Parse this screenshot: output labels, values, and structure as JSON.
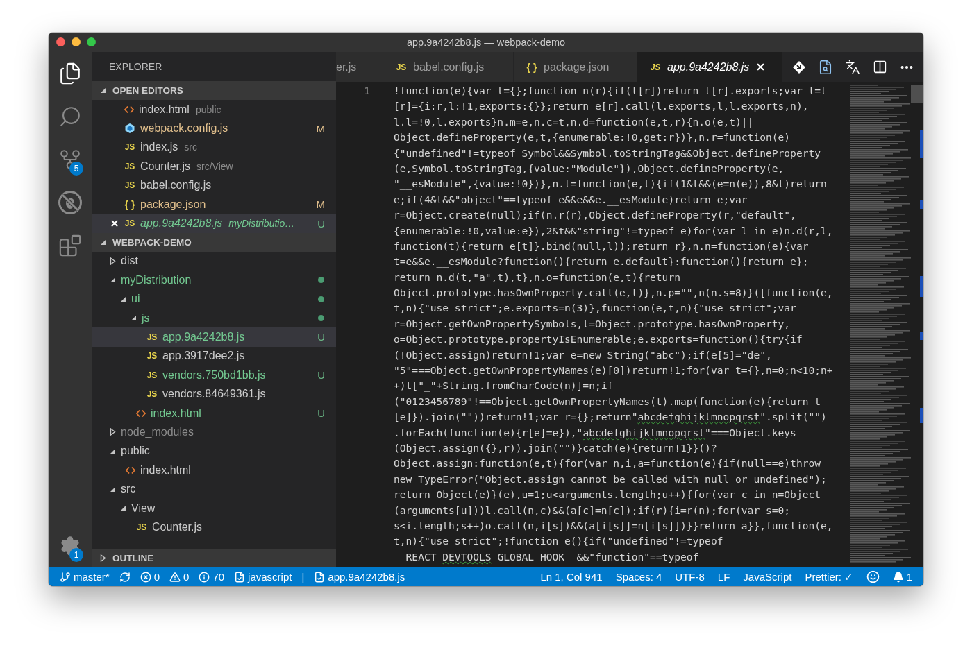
{
  "window": {
    "title": "app.9a4242b8.js — webpack-demo"
  },
  "activity_bar": {
    "items": [
      {
        "kind": "files",
        "selected": true
      },
      {
        "kind": "search",
        "selected": false
      },
      {
        "kind": "source-control",
        "selected": false,
        "badge": "5"
      },
      {
        "kind": "debug",
        "selected": false
      },
      {
        "kind": "extensions",
        "selected": false
      }
    ],
    "settings": {
      "badge": "1"
    }
  },
  "sidebar": {
    "title": "EXPLORER",
    "open_editors": {
      "title": "OPEN EDITORS",
      "expanded": true,
      "items": [
        {
          "kind": "html",
          "name": "index.html",
          "description": "public",
          "color": "#cccccc",
          "selected": false,
          "preview": false
        },
        {
          "kind": "webpack",
          "name": "webpack.config.js",
          "color": "#e2c08d",
          "decoration": "M",
          "selected": false,
          "preview": false
        },
        {
          "kind": "js",
          "glyph": "JS",
          "name": "index.js",
          "description": "src",
          "color": "#cccccc",
          "selected": false,
          "preview": false
        },
        {
          "kind": "js",
          "glyph": "JS",
          "name": "Counter.js",
          "description": "src/View",
          "color": "#cccccc",
          "selected": false,
          "preview": false
        },
        {
          "kind": "js",
          "glyph": "JS",
          "name": "babel.config.js",
          "color": "#cccccc",
          "selected": false,
          "preview": false
        },
        {
          "kind": "json",
          "glyph": "{ }",
          "name": "package.json",
          "color": "#e2c08d",
          "decoration": "M",
          "selected": false,
          "preview": false
        },
        {
          "kind": "js",
          "glyph": "JS",
          "name": "app.9a4242b8.js",
          "description": "myDistributio…",
          "color": "#73c991",
          "decoration": "U",
          "selected": true,
          "preview": true
        }
      ]
    },
    "project": {
      "title": "WEBPACK-DEMO",
      "expanded": true,
      "tree": [
        {
          "kind": "folder",
          "name": "dist",
          "expanded": false,
          "color": "#cccccc",
          "dot": false
        },
        {
          "kind": "folder",
          "name": "myDistribution",
          "expanded": true,
          "color": "#73c991",
          "dot": true,
          "children": [
            {
              "kind": "folder",
              "name": "ui",
              "expanded": true,
              "color": "#73c991",
              "dot": true,
              "children": [
                {
                  "kind": "folder",
                  "name": "js",
                  "expanded": true,
                  "color": "#73c991",
                  "dot": true,
                  "children": [
                    {
                      "kind": "js",
                      "glyph": "JS",
                      "name": "app.9a4242b8.js",
                      "color": "#73c991",
                      "dot": false,
                      "decoration": "U",
                      "selected": true
                    },
                    {
                      "kind": "js",
                      "glyph": "JS",
                      "name": "app.3917dee2.js",
                      "color": "#cccccc",
                      "dot": false,
                      "selected": false
                    },
                    {
                      "kind": "js",
                      "glyph": "JS",
                      "name": "vendors.750bd1bb.js",
                      "color": "#73c991",
                      "dot": false,
                      "decoration": "U",
                      "selected": false
                    },
                    {
                      "kind": "js",
                      "glyph": "JS",
                      "name": "vendors.84649361.js",
                      "color": "#cccccc",
                      "dot": false,
                      "selected": false
                    }
                  ]
                },
                {
                  "kind": "html",
                  "name": "index.html",
                  "color": "#73c991",
                  "dot": false,
                  "decoration": "U",
                  "selected": false
                }
              ]
            }
          ]
        },
        {
          "kind": "folder",
          "name": "node_modules",
          "expanded": false,
          "color": "#8c8c8c",
          "dot": false
        },
        {
          "kind": "folder",
          "name": "public",
          "expanded": true,
          "color": "#cccccc",
          "dot": false,
          "children": [
            {
              "kind": "html",
              "name": "index.html",
              "color": "#cccccc",
              "dot": false,
              "selected": false
            }
          ]
        },
        {
          "kind": "folder",
          "name": "src",
          "expanded": true,
          "color": "#cccccc",
          "dot": false,
          "children": [
            {
              "kind": "folder",
              "name": "View",
              "expanded": true,
              "color": "#cccccc",
              "dot": false,
              "children": [
                {
                  "kind": "js",
                  "glyph": "JS",
                  "name": "Counter.js",
                  "color": "#cccccc",
                  "dot": false,
                  "selected": false
                }
              ]
            }
          ]
        }
      ]
    },
    "outline": {
      "title": "OUTLINE",
      "expanded": false
    }
  },
  "tabs": [
    {
      "kind": "none",
      "label": "er.js",
      "selected": false,
      "preview": false
    },
    {
      "kind": "js",
      "glyph": "JS",
      "label": "babel.config.js",
      "selected": false,
      "preview": false
    },
    {
      "kind": "json",
      "glyph": "{ }",
      "label": "package.json",
      "selected": false,
      "preview": false
    },
    {
      "kind": "js",
      "glyph": "JS",
      "label": "app.9a4242b8.js",
      "selected": true,
      "preview": true
    }
  ],
  "editor": {
    "line_number": "1",
    "lines": [
      {
        "segments": [
          {
            "text": "!function(e){var t={};function n(r){if(t[r])return t[r].exports;var l=t",
            "squiggle": false
          }
        ]
      },
      {
        "segments": [
          {
            "text": "[r]={i:r,l:!1,exports:{}};return e[r].call(l.exports,l,l.exports,n),",
            "squiggle": false
          }
        ]
      },
      {
        "segments": [
          {
            "text": "l.l=!0,l.exports}n.m=e,n.c=t,n.d=function(e,t,r){n.o(e,t)||",
            "squiggle": false
          }
        ]
      },
      {
        "segments": [
          {
            "text": "Object.defineProperty(e,t,{enumerable:!0,get:r})},n.r=function(e)",
            "squiggle": false
          }
        ]
      },
      {
        "segments": [
          {
            "text": "{\"undefined\"!=typeof Symbol&&Symbol.toStringTag&&Object.defineProperty",
            "squiggle": false
          }
        ]
      },
      {
        "segments": [
          {
            "text": "(e,Symbol.toStringTag,{value:\"Module\"}),Object.defineProperty(e,",
            "squiggle": false
          }
        ]
      },
      {
        "segments": [
          {
            "text": "\"__esModule\",{value:!0})},n.t=function(e,t){if(1&t&&(e=n(e)),8&t)return",
            "squiggle": false
          }
        ]
      },
      {
        "segments": [
          {
            "text": "e;if(4&t&&\"object\"==typeof e&&e&&e.__esModule)return e;var",
            "squiggle": false
          }
        ]
      },
      {
        "segments": [
          {
            "text": "r=Object.create(null);if(n.r(r),Object.defineProperty(r,\"default\",",
            "squiggle": false
          }
        ]
      },
      {
        "segments": [
          {
            "text": "{enumerable:!0,value:e}),2&t&&\"string\"!=typeof e)for(var l in e)n.d(r,l,",
            "squiggle": false
          }
        ]
      },
      {
        "segments": [
          {
            "text": "function(t){return e[t]}.bind(null,l));return r},n.n=function(e){var",
            "squiggle": false
          }
        ]
      },
      {
        "segments": [
          {
            "text": "t=e&&e.__esModule?function(){return e.default}:function(){return e};",
            "squiggle": false
          }
        ]
      },
      {
        "segments": [
          {
            "text": "return n.d(t,\"a\",t),t},n.o=function(e,t){return",
            "squiggle": false
          }
        ]
      },
      {
        "segments": [
          {
            "text": "Object.prototype.hasOwnProperty.call(e,t)},n.p=\"\",n(n.s=8)}([function(e,",
            "squiggle": false
          }
        ]
      },
      {
        "segments": [
          {
            "text": "t,n){\"use strict\";e.exports=n(3)},function(e,t,n){\"use strict\";var",
            "squiggle": false
          }
        ]
      },
      {
        "segments": [
          {
            "text": "r=Object.getOwnPropertySymbols,l=Object.prototype.hasOwnProperty,",
            "squiggle": false
          }
        ]
      },
      {
        "segments": [
          {
            "text": "o=Object.prototype.propertyIsEnumerable;e.exports=function(){try{if",
            "squiggle": false
          }
        ]
      },
      {
        "segments": [
          {
            "text": "(!Object.assign)return!1;var e=new String(\"abc\");if(e[5]=\"de\",",
            "squiggle": false
          }
        ]
      },
      {
        "segments": [
          {
            "text": "\"5\"===Object.getOwnPropertyNames(e)[0])return!1;for(var t={},n=0;n<10;n+",
            "squiggle": false
          }
        ]
      },
      {
        "segments": [
          {
            "text": "+)t[\"_\"+String.fromCharCode(n)]=n;if",
            "squiggle": false
          }
        ]
      },
      {
        "segments": [
          {
            "text": "(\"0123456789\"!==Object.getOwnPropertyNames(t).map(function(e){return t",
            "squiggle": false
          }
        ]
      },
      {
        "segments": [
          {
            "text": "[e]}).join(\"\"))return!1;var r={};return\"",
            "squiggle": false
          },
          {
            "text": "abcdefghijklmnopqrst",
            "squiggle": true
          },
          {
            "text": "\".split(\"\")",
            "squiggle": false
          }
        ]
      },
      {
        "segments": [
          {
            "text": ".forEach(function(e){r[e]=e}),\"",
            "squiggle": false
          },
          {
            "text": "abcdefghijklmnopqrst",
            "squiggle": true
          },
          {
            "text": "\"===Object.keys",
            "squiggle": false
          }
        ]
      },
      {
        "segments": [
          {
            "text": "(Object.assign({},r)).join(\"\")}catch(e){return!1}}()?",
            "squiggle": false
          }
        ]
      },
      {
        "segments": [
          {
            "text": "Object.assign:function(e,t){for(var n,i,a=function(e){if(null==e)throw",
            "squiggle": false
          }
        ]
      },
      {
        "segments": [
          {
            "text": "new TypeError(\"Object.assign cannot be called with null or undefined\");",
            "squiggle": false
          }
        ]
      },
      {
        "segments": [
          {
            "text": "return Object(e)}(e),u=1;u<arguments.length;u++){for(var c in n=Object",
            "squiggle": false
          }
        ]
      },
      {
        "segments": [
          {
            "text": "(arguments[u]))l.call(n,c)&&(a[c]=n[c]);if(r){i=r(n);for(var s=0;",
            "squiggle": false
          }
        ]
      },
      {
        "segments": [
          {
            "text": "s<i.length;s++)o.call(n,i[s])&&(a[i[s]]=n[i[s]])}}return a}},function(e,",
            "squiggle": false
          }
        ]
      },
      {
        "segments": [
          {
            "text": "t,n){\"use strict\";!function e(){if(\"undefined\"!=typeof",
            "squiggle": false
          }
        ]
      },
      {
        "segments": [
          {
            "text": "__REACT_",
            "squiggle": false
          },
          {
            "text": "DEVTOOLS",
            "squiggle": true
          },
          {
            "text": "_GLOBAL_HOOK__&&\"function\"==typeof",
            "squiggle": false
          }
        ]
      }
    ]
  },
  "status_bar": {
    "left": [
      {
        "kind": "branch",
        "text": "master*"
      },
      {
        "kind": "sync"
      },
      {
        "kind": "errors",
        "text": "0"
      },
      {
        "kind": "warnings",
        "text": "0"
      },
      {
        "kind": "infos",
        "text": "70"
      },
      {
        "kind": "doc",
        "text": "javascript"
      },
      {
        "kind": "plain",
        "text": "|"
      },
      {
        "kind": "doc",
        "text": "app.9a4242b8.js"
      }
    ],
    "right": [
      {
        "kind": "plain",
        "text": "Ln 1, Col 941"
      },
      {
        "kind": "plain",
        "text": "Spaces: 4"
      },
      {
        "kind": "plain",
        "text": "UTF-8"
      },
      {
        "kind": "plain",
        "text": "LF"
      },
      {
        "kind": "plain",
        "text": "JavaScript"
      },
      {
        "kind": "plain",
        "text": "Prettier: ✓"
      },
      {
        "kind": "feedback"
      },
      {
        "kind": "bell",
        "text": "1"
      }
    ]
  }
}
